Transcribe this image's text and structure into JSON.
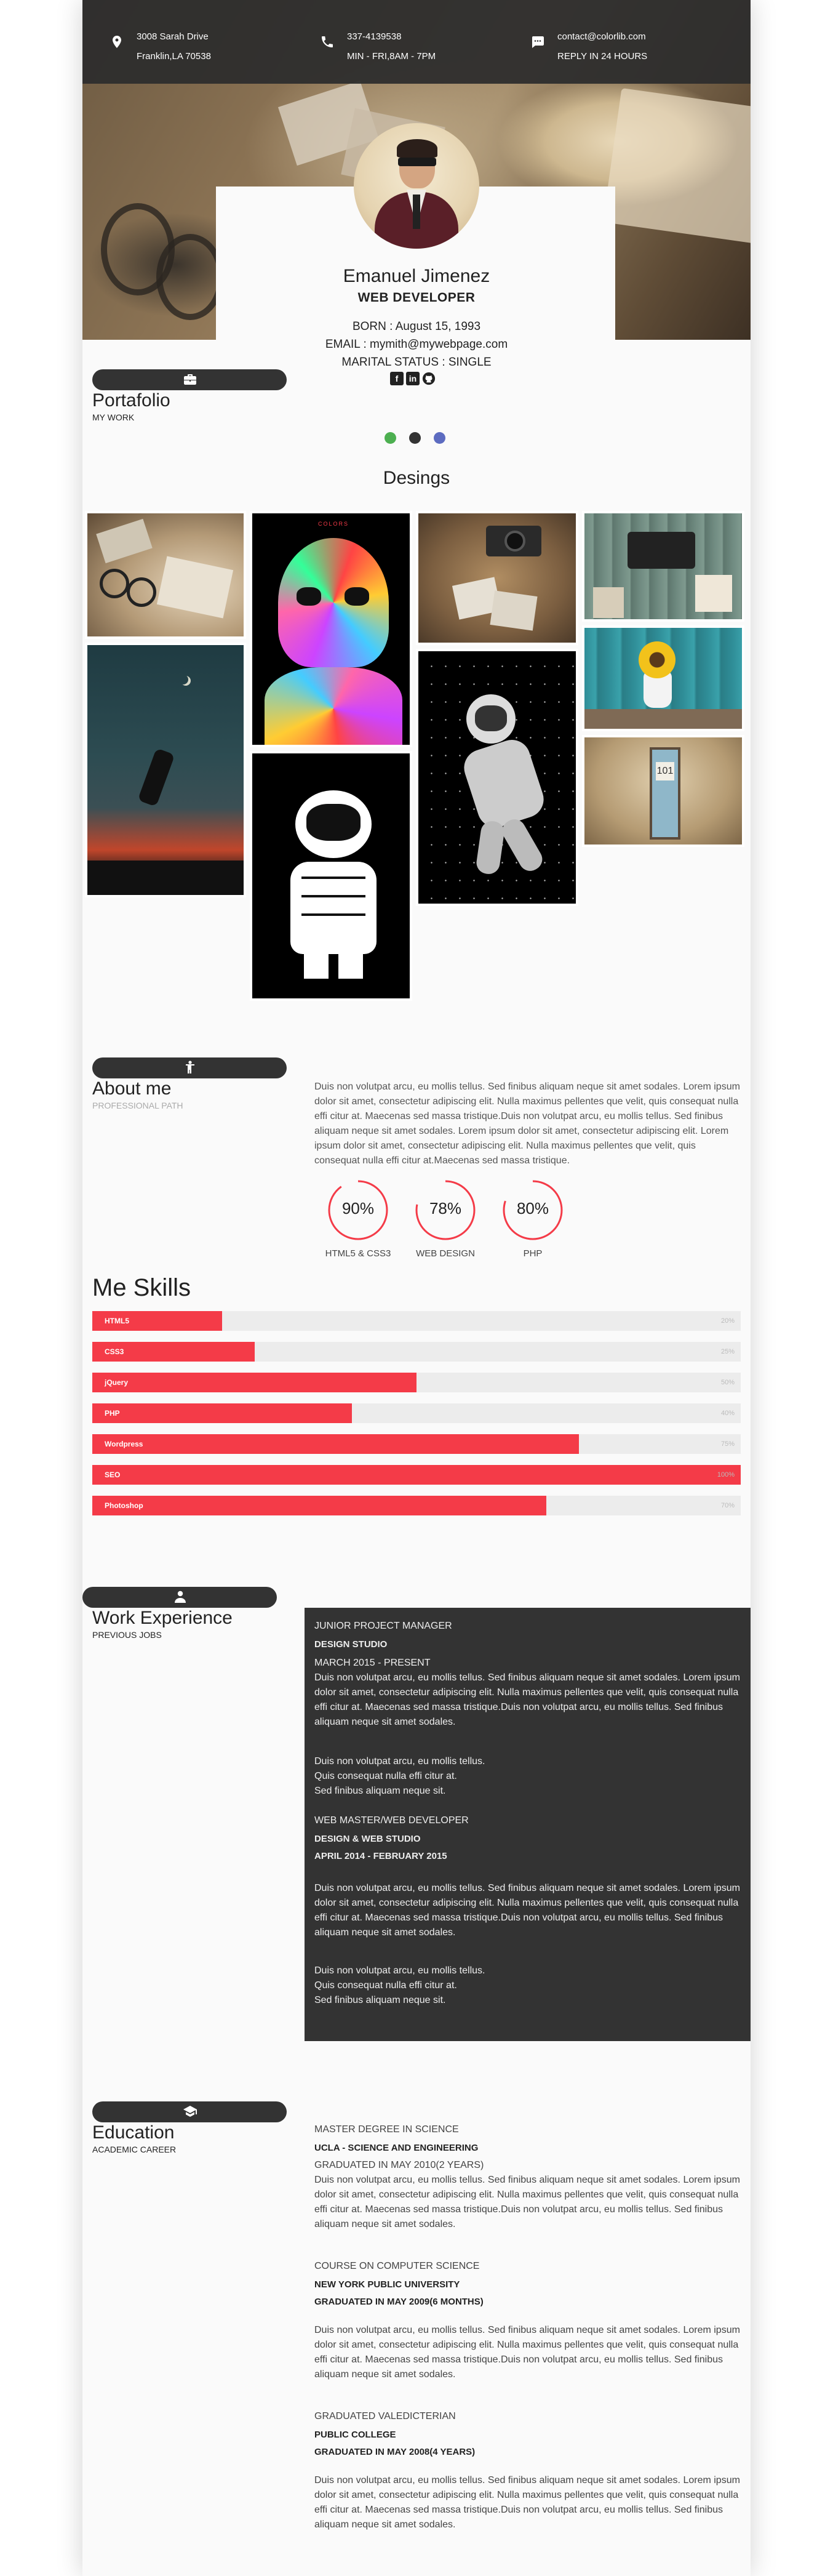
{
  "contact": {
    "address_line1": "3008 Sarah Drive",
    "address_line2": "Franklin,LA 70538",
    "phone": "337-4139538",
    "hours": "MIN - FRI,8AM - 7PM",
    "email": "contact@colorlib.com",
    "reply": "REPLY IN 24 HOURS"
  },
  "profile": {
    "name": "Emanuel Jimenez",
    "role": "WEB DEVELOPER",
    "born": "BORN : August 15, 1993",
    "email": "EMAIL : mymith@mywebpage.com",
    "marital": "MARITAL STATUS : SINGLE"
  },
  "social_icons": [
    "facebook-icon",
    "linkedin-icon",
    "github-icon"
  ],
  "portfolio": {
    "title": "Portafolio",
    "subtitle": "MY WORK",
    "dot_colors": [
      "#4caf50",
      "#333333",
      "#5c6bc0"
    ],
    "gallery_title": "Desings"
  },
  "about": {
    "title": "About me",
    "subtitle": "PROFESSIONAL PATH",
    "text": "Duis non volutpat arcu, eu mollis tellus. Sed finibus aliquam neque sit amet sodales. Lorem ipsum dolor sit amet, consectetur adipiscing elit. Nulla maximus pellentes que velit, quis consequat nulla effi citur at. Maecenas sed massa tristique.Duis non volutpat arcu, eu mollis tellus. Sed finibus aliquam neque sit amet sodales. Lorem ipsum dolor sit amet, consectetur adipiscing elit. Lorem ipsum dolor sit amet, consectetur adipiscing elit. Nulla maximus pellentes que velit, quis consequat nulla effi citur at.Maecenas sed massa tristique.",
    "circles": [
      {
        "pct": "90%",
        "label": "HTML5 & CSS3",
        "value": 0.9
      },
      {
        "pct": "78%",
        "label": "WEB DESIGN",
        "value": 0.78
      },
      {
        "pct": "80%",
        "label": "PHP",
        "value": 0.8
      }
    ]
  },
  "skills": {
    "title": "Me Skills",
    "items": [
      {
        "name": "HTML5",
        "pct": "20%",
        "value": 0.2
      },
      {
        "name": "CSS3",
        "pct": "25%",
        "value": 0.25
      },
      {
        "name": "jQuery",
        "pct": "50%",
        "value": 0.5
      },
      {
        "name": "PHP",
        "pct": "40%",
        "value": 0.4
      },
      {
        "name": "Wordpress",
        "pct": "75%",
        "value": 0.75
      },
      {
        "name": "SEO",
        "pct": "100%",
        "value": 1.0
      },
      {
        "name": "Photoshop",
        "pct": "70%",
        "value": 0.7
      }
    ]
  },
  "experience": {
    "title": "Work Experience",
    "subtitle": "PREVIOUS JOBS",
    "jobs": [
      {
        "position": "JUNIOR PROJECT MANAGER",
        "company": "DESIGN STUDIO",
        "period": "MARCH 2015 - PRESENT",
        "text": "Duis non volutpat arcu, eu mollis tellus. Sed finibus aliquam neque sit amet sodales. Lorem ipsum dolor sit amet, consectetur adipiscing elit. Nulla maximus pellentes que velit, quis consequat nulla effi citur at. Maecenas sed massa tristique.Duis non volutpat arcu, eu mollis tellus. Sed finibus aliquam neque sit amet sodales.",
        "extra1": "Duis non volutpat arcu, eu mollis tellus.",
        "extra2": "Quis consequat nulla effi citur at.",
        "extra3": "Sed finibus aliquam neque sit."
      },
      {
        "position": "WEB MASTER/WEB DEVELOPER",
        "company": "DESIGN & WEB STUDIO",
        "period": "APRIL 2014 - FEBRUARY 2015",
        "text": "Duis non volutpat arcu, eu mollis tellus. Sed finibus aliquam neque sit amet sodales. Lorem ipsum dolor sit amet, consectetur adipiscing elit. Nulla maximus pellentes que velit, quis consequat nulla effi citur at. Maecenas sed massa tristique.Duis non volutpat arcu, eu mollis tellus. Sed finibus aliquam neque sit amet sodales.",
        "extra1": "Duis non volutpat arcu, eu mollis tellus.",
        "extra2": "Quis consequat nulla effi citur at.",
        "extra3": "Sed finibus aliquam neque sit."
      }
    ]
  },
  "education": {
    "title": "Education",
    "subtitle": "ACADEMIC CAREER",
    "items": [
      {
        "degree": "MASTER DEGREE IN SCIENCE",
        "school": "UCLA - SCIENCE AND ENGINEERING",
        "graduated": "GRADUATED IN MAY 2010(2 YEARS)",
        "text": "Duis non volutpat arcu, eu mollis tellus. Sed finibus aliquam neque sit amet sodales. Lorem ipsum dolor sit amet, consectetur adipiscing elit. Nulla maximus pellentes que velit, quis consequat nulla effi citur at. Maecenas sed massa tristique.Duis non volutpat arcu, eu mollis tellus. Sed finibus aliquam neque sit amet sodales."
      },
      {
        "degree": "COURSE ON COMPUTER SCIENCE",
        "school": "NEW YORK PUBLIC UNIVERSITY",
        "graduated": "GRADUATED IN MAY 2009(6 MONTHS)",
        "text": "Duis non volutpat arcu, eu mollis tellus. Sed finibus aliquam neque sit amet sodales. Lorem ipsum dolor sit amet, consectetur adipiscing elit. Nulla maximus pellentes que velit, quis consequat nulla effi citur at. Maecenas sed massa tristique.Duis non volutpat arcu, eu mollis tellus. Sed finibus aliquam neque sit amet sodales."
      },
      {
        "degree": "GRADUATED VALEDICTERIAN",
        "school": "PUBLIC COLLEGE",
        "graduated": "GRADUATED IN MAY 2008(4 YEARS)",
        "text": "Duis non volutpat arcu, eu mollis tellus. Sed finibus aliquam neque sit amet sodales. Lorem ipsum dolor sit amet, consectetur adipiscing elit. Nulla maximus pellentes que velit, quis consequat nulla effi citur at. Maecenas sed massa tristique.Duis non volutpat arcu, eu mollis tellus. Sed finibus aliquam neque sit amet sodales."
      }
    ]
  },
  "colors": {
    "accent": "#f43b48",
    "dark": "#333333"
  }
}
